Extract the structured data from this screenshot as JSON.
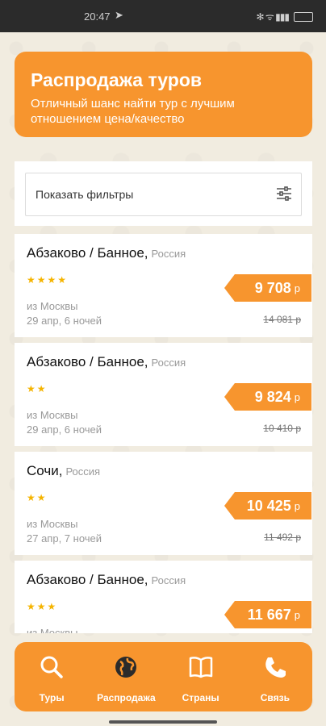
{
  "status_bar": {
    "time": "20:47",
    "right_icons": "✻ ᯤ ▮▮▮"
  },
  "banner": {
    "title": "Распродажа туров",
    "subtitle": "Отличный шанс найти тур с лучшим отношением цена/качество"
  },
  "filter": {
    "label": "Показать фильтры",
    "icon": "filter-sliders-icon"
  },
  "tours": [
    {
      "title": "Абзаково / Банное,",
      "country": "Россия",
      "stars": "★★★★",
      "from": "из Москвы",
      "dates": "29 апр, 6 ночей",
      "price": "9 708",
      "currency": "р",
      "old_price": "14 081 р"
    },
    {
      "title": "Абзаково / Банное,",
      "country": "Россия",
      "stars": "★★",
      "from": "из Москвы",
      "dates": "29 апр, 6 ночей",
      "price": "9 824",
      "currency": "р",
      "old_price": "10 410 р"
    },
    {
      "title": "Сочи,",
      "country": "Россия",
      "stars": "★★",
      "from": "из Москвы",
      "dates": "27 апр, 7 ночей",
      "price": "10 425",
      "currency": "р",
      "old_price": "11 492 р"
    },
    {
      "title": "Абзаково / Банное,",
      "country": "Россия",
      "stars": "★★★",
      "from": "из Москвы",
      "dates": "",
      "price": "11 667",
      "currency": "р",
      "old_price": ""
    }
  ],
  "nav": [
    {
      "label": "Туры",
      "icon": "search-icon"
    },
    {
      "label": "Распродажа",
      "icon": "globe-icon"
    },
    {
      "label": "Страны",
      "icon": "book-icon"
    },
    {
      "label": "Связь",
      "icon": "phone-icon"
    }
  ],
  "colors": {
    "accent": "#f7952e",
    "background": "#f1ece0",
    "stars": "#f5b400"
  }
}
